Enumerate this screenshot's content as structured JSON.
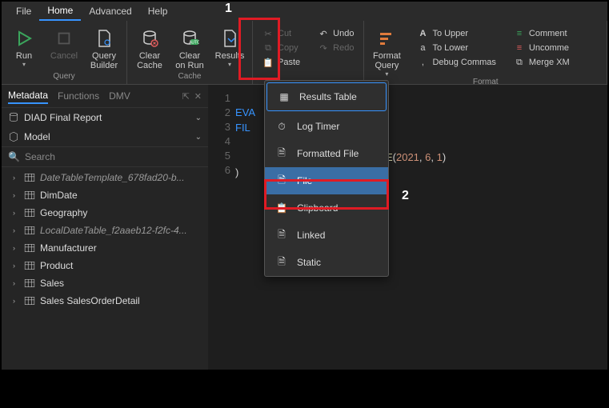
{
  "menubar": {
    "file": "File",
    "home": "Home",
    "advanced": "Advanced",
    "help": "Help"
  },
  "ribbon": {
    "query_group": "Query",
    "cache_group": "Cache",
    "format_group": "Format",
    "run": "Run",
    "cancel": "Cancel",
    "query_builder": "Query\nBuilder",
    "clear_cache": "Clear\nCache",
    "clear_on_run": "Clear\non Run",
    "results": "Results",
    "cut": "Cut",
    "copy": "Copy",
    "paste": "Paste",
    "undo": "Undo",
    "redo": "Redo",
    "format_query": "Format\nQuery",
    "to_upper": "To Upper",
    "to_lower": "To Lower",
    "debug_commas": "Debug Commas",
    "comment": "Comment",
    "uncomme": "Uncomme",
    "merge_xm": "Merge XM"
  },
  "annotations": {
    "one": "1",
    "two": "2"
  },
  "leftpanel": {
    "tabs": {
      "metadata": "Metadata",
      "functions": "Functions",
      "dmv": "DMV"
    },
    "db": "DIAD Final Report",
    "model": "Model",
    "search": "Search",
    "tables": [
      {
        "label": "DateTableTemplate_678fad20-b...",
        "italic": true
      },
      {
        "label": "DimDate",
        "italic": false
      },
      {
        "label": "Geography",
        "italic": false
      },
      {
        "label": "LocalDateTable_f2aaeb12-f2fc-4...",
        "italic": true
      },
      {
        "label": "Manufacturer",
        "italic": false
      },
      {
        "label": "Product",
        "italic": false
      },
      {
        "label": "Sales",
        "italic": false
      },
      {
        "label": "Sales SalesOrderDetail",
        "italic": false
      }
    ]
  },
  "editor": {
    "lines": [
      "1",
      "2",
      "3",
      "4",
      "5",
      "6"
    ],
    "code": {
      "l1_kw": "EVA",
      "l2_kw": "FIL",
      "l4_fn": "TE",
      "l4_open": "(",
      "l4_a": "2021",
      "l4_c1": ", ",
      "l4_b": "6",
      "l4_c2": ", ",
      "l4_c": "1",
      "l4_close": ")",
      "l5_close": ")"
    }
  },
  "dropdown": {
    "items": [
      "Results Table",
      "Log Timer",
      "Formatted File",
      "File",
      "Clipboard",
      "Linked",
      "Static"
    ]
  }
}
